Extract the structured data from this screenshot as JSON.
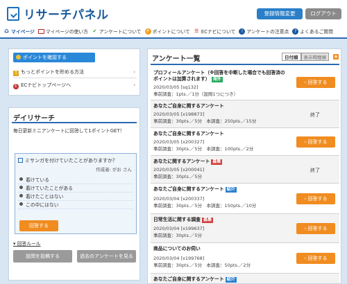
{
  "header": {
    "logo_text": "リサーチパネル",
    "register_label": "登録情報変更",
    "logout_label": "ログアウト"
  },
  "nav": [
    {
      "label": "マイページ",
      "icon": "home-icon"
    },
    {
      "label": "マイページの使い方",
      "icon": "pc-icon"
    },
    {
      "label": "アンケートについて",
      "icon": "check-icon"
    },
    {
      "label": "ポイントについて",
      "icon": "coin-icon"
    },
    {
      "label": "ECナビについて",
      "icon": "cart-icon"
    },
    {
      "label": "アンケートの注意点",
      "icon": "info-icon"
    },
    {
      "label": "よくあるご質問",
      "icon": "faq-icon"
    }
  ],
  "left_links": {
    "points_button": "ポイントを確認する",
    "more_points": "もっとポイントを貯める方法",
    "ec_top": "ECナビトップページへ"
  },
  "daily": {
    "title": "デイリサーチ",
    "description": "毎日更新ミニアンケートに回答して1ポイントGET！",
    "question": "ミサンガを付けていたことがありますか？",
    "author": "作成者: がお さん",
    "options": [
      "着けている",
      "着けていたことがある",
      "着けたことはない",
      "この中にはない"
    ],
    "submit": "回答する",
    "rules": "回答ルール",
    "post_button": "設問を投稿する",
    "past_button": "過去のアンケートを見る"
  },
  "surveys": {
    "title": "アンケート一覧",
    "sort_on": "日付順",
    "sort_off": "表示時間順",
    "answer_label": "回答する",
    "ended_label": "終了",
    "items": [
      {
        "title": "プロフィールアンケート（※回答を中断した場合でも回答済のポイントは加算されます）",
        "badge": "海外",
        "date": "2020/03/05 [sq132]",
        "meta": "事前調査：1pts.／1分（設問1つにつき）"
      },
      {
        "title": "あなたご自身に関するアンケート",
        "badge": "",
        "date": "2020/03/05 [x198873]",
        "meta": "事前調査：30pts.／5分　本調査：250pts.／15分"
      },
      {
        "title": "あなたご自身に関するアンケート",
        "badge": "",
        "date": "2020/03/05 [x200327]",
        "meta": "事前調査：30pts.／5分　本調査：100pts.／2分"
      },
      {
        "title": "あなたに関するアンケート",
        "badge": "募集",
        "date": "2020/03/05 [x200041]",
        "meta": "事前調査：30pts.／5分"
      },
      {
        "title": "あなたご自身に関するアンケート",
        "badge": "紹介",
        "date": "2020/03/04 [x200337]",
        "meta": "事前調査：30pts.／5分　本調査：150pts.／10分"
      },
      {
        "title": "日常生活に関する調査",
        "badge": "募集",
        "date": "2020/03/04 [x199637]",
        "meta": "事前調査：30pts.／5分"
      },
      {
        "title": "商品についてのお伺い",
        "badge": "",
        "date": "2020/03/04 [x199768]",
        "meta": "事前調査：30pts.／5分　本調査：50pts.／2分"
      },
      {
        "title": "あなたご自身に関するアンケート",
        "badge": "紹介",
        "date": "",
        "meta": ""
      }
    ]
  },
  "colors": {
    "accent": "#1a5aa0",
    "orange": "#f08c20",
    "header_blue": "#2a7fc8"
  }
}
